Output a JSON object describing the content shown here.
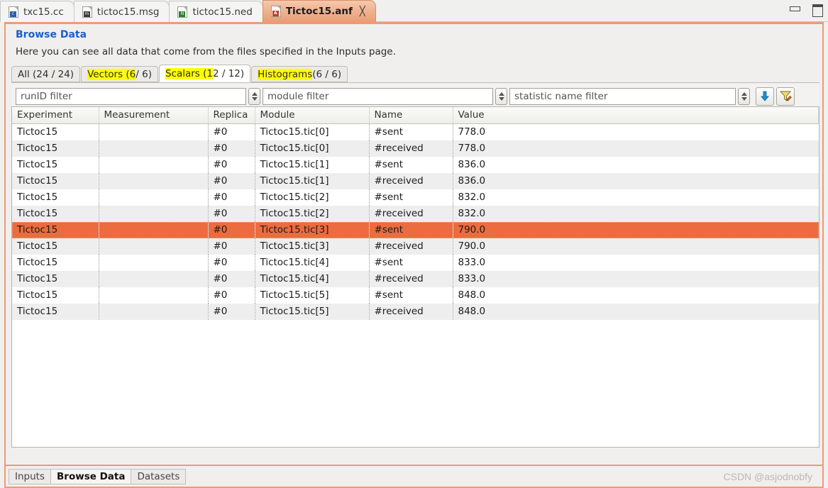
{
  "window": {
    "minimize_label": "minimize",
    "maximize_label": "maximize"
  },
  "editor_tabs": [
    {
      "label": "txc15.cc",
      "icon": "c-file-icon",
      "glyph": "c",
      "active": false,
      "closable": false
    },
    {
      "label": "tictoc15.msg",
      "icon": "msg-file-icon",
      "glyph": "m",
      "active": false,
      "closable": false
    },
    {
      "label": "tictoc15.ned",
      "icon": "ned-file-icon",
      "glyph": "N",
      "active": false,
      "closable": false
    },
    {
      "label": "Tictoc15.anf",
      "icon": "anf-file-icon",
      "glyph": "A",
      "active": true,
      "closable": true,
      "close_glyph": "╳"
    }
  ],
  "page": {
    "title": "Browse Data",
    "description": "Here you can see all data that come from the files specified in the Inputs page."
  },
  "inner_tabs": [
    {
      "label": "All (24 / 24)",
      "plain": "All (24 / 24)",
      "highlight": "",
      "rest": "",
      "active": false
    },
    {
      "label": "Vectors (6 / 6)",
      "plain": "",
      "highlight": "Vectors (6",
      "rest": " / 6)",
      "active": false
    },
    {
      "label": "Scalars (12 / 12)",
      "plain": "",
      "highlight": "Scalars (1",
      "rest": "2 / 12)",
      "active": true
    },
    {
      "label": "Histograms (6 / 6)",
      "plain": "",
      "highlight": "Histograms",
      "rest": " (6 / 6)",
      "active": false
    }
  ],
  "filters": {
    "runid": {
      "value": "runID filter",
      "placeholder": "runID filter"
    },
    "module": {
      "value": "module filter",
      "placeholder": "module filter"
    },
    "statistic": {
      "value": "statistic name filter",
      "placeholder": "statistic name filter"
    },
    "buttons": [
      {
        "name": "export-arrow-button",
        "tooltip": "Export"
      },
      {
        "name": "edit-filter-button",
        "tooltip": "Edit filter"
      }
    ]
  },
  "table": {
    "columns": [
      "Experiment",
      "Measurement",
      "Replica",
      "Module",
      "Name",
      "Value"
    ],
    "rows": [
      {
        "experiment": "Tictoc15",
        "measurement": "",
        "replica": "#0",
        "module": "Tictoc15.tic[0]",
        "name": "#sent",
        "value": "778.0",
        "selected": false
      },
      {
        "experiment": "Tictoc15",
        "measurement": "",
        "replica": "#0",
        "module": "Tictoc15.tic[0]",
        "name": "#received",
        "value": "778.0",
        "selected": false
      },
      {
        "experiment": "Tictoc15",
        "measurement": "",
        "replica": "#0",
        "module": "Tictoc15.tic[1]",
        "name": "#sent",
        "value": "836.0",
        "selected": false
      },
      {
        "experiment": "Tictoc15",
        "measurement": "",
        "replica": "#0",
        "module": "Tictoc15.tic[1]",
        "name": "#received",
        "value": "836.0",
        "selected": false
      },
      {
        "experiment": "Tictoc15",
        "measurement": "",
        "replica": "#0",
        "module": "Tictoc15.tic[2]",
        "name": "#sent",
        "value": "832.0",
        "selected": false
      },
      {
        "experiment": "Tictoc15",
        "measurement": "",
        "replica": "#0",
        "module": "Tictoc15.tic[2]",
        "name": "#received",
        "value": "832.0",
        "selected": false
      },
      {
        "experiment": "Tictoc15",
        "measurement": "",
        "replica": "#0",
        "module": "Tictoc15.tic[3]",
        "name": "#sent",
        "value": "790.0",
        "selected": true
      },
      {
        "experiment": "Tictoc15",
        "measurement": "",
        "replica": "#0",
        "module": "Tictoc15.tic[3]",
        "name": "#received",
        "value": "790.0",
        "selected": false
      },
      {
        "experiment": "Tictoc15",
        "measurement": "",
        "replica": "#0",
        "module": "Tictoc15.tic[4]",
        "name": "#sent",
        "value": "833.0",
        "selected": false
      },
      {
        "experiment": "Tictoc15",
        "measurement": "",
        "replica": "#0",
        "module": "Tictoc15.tic[4]",
        "name": "#received",
        "value": "833.0",
        "selected": false
      },
      {
        "experiment": "Tictoc15",
        "measurement": "",
        "replica": "#0",
        "module": "Tictoc15.tic[5]",
        "name": "#sent",
        "value": "848.0",
        "selected": false
      },
      {
        "experiment": "Tictoc15",
        "measurement": "",
        "replica": "#0",
        "module": "Tictoc15.tic[5]",
        "name": "#received",
        "value": "848.0",
        "selected": false
      }
    ]
  },
  "bottom_tabs": [
    {
      "label": "Inputs",
      "active": false
    },
    {
      "label": "Browse Data",
      "active": true
    },
    {
      "label": "Datasets",
      "active": false
    }
  ],
  "watermark": "CSDN @asjodnobfy",
  "colors": {
    "accent_orange": "#ef9a76",
    "selection_orange": "#ec6b3f",
    "title_blue": "#1a5fd0",
    "highlight_yellow": "#ffff00"
  }
}
